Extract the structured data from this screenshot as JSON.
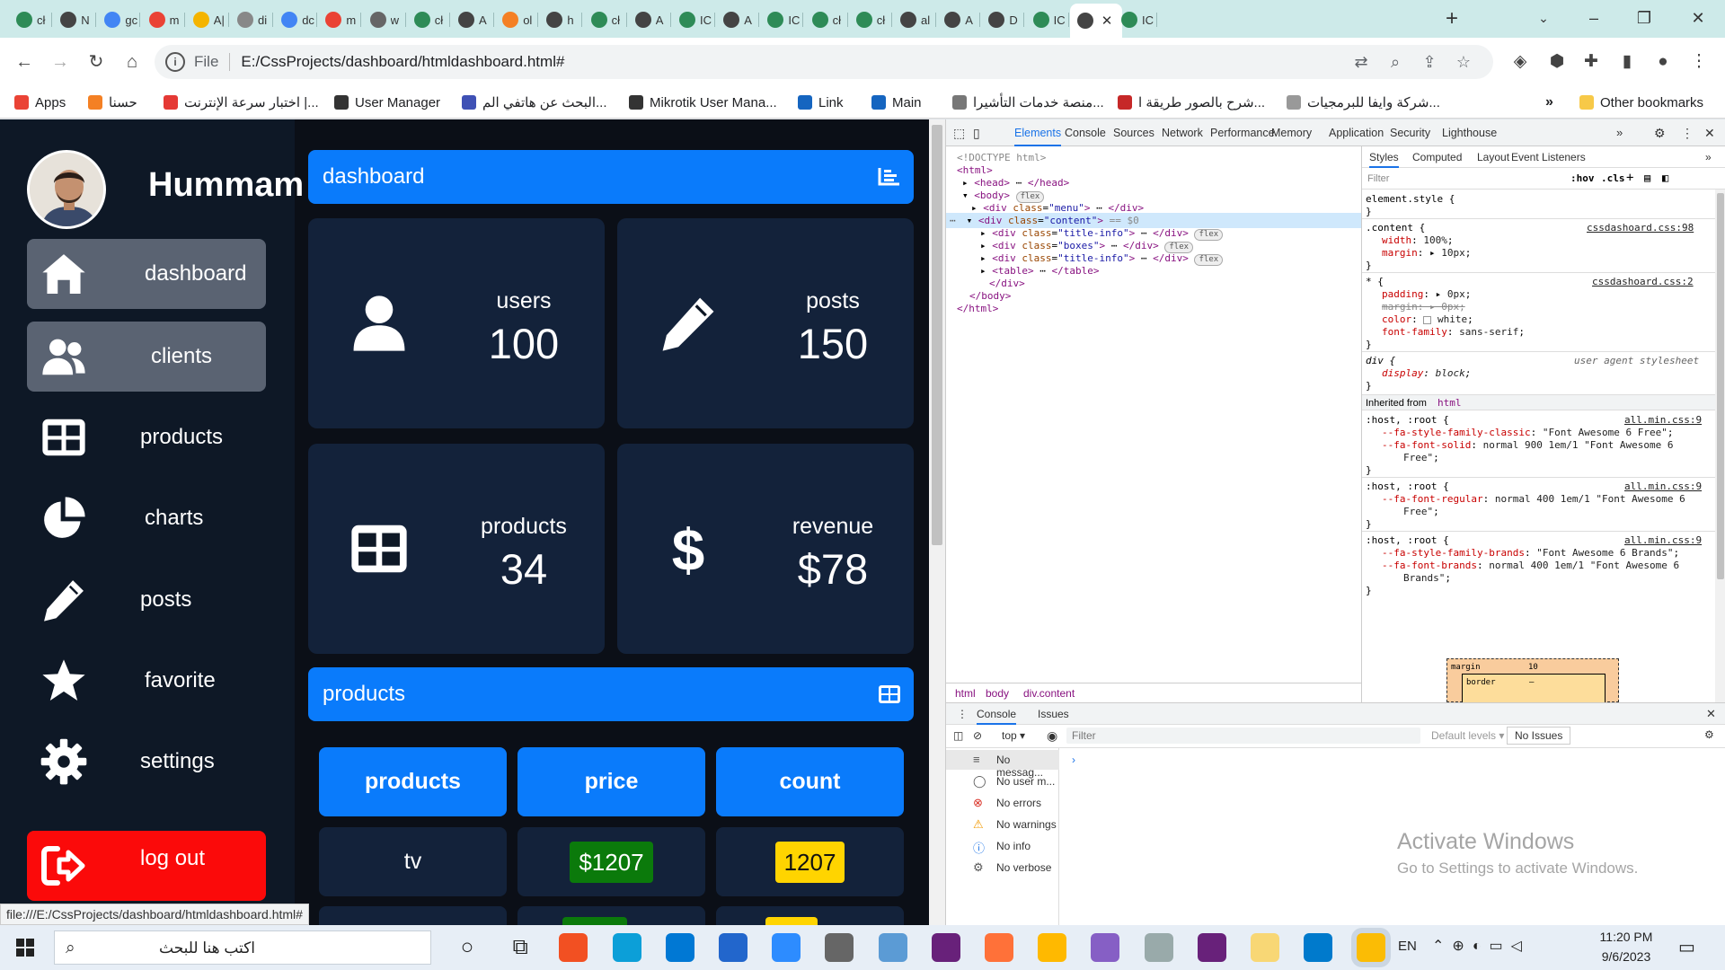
{
  "browser": {
    "tabs": [
      {
        "label": "cł",
        "color": "#2e8b57"
      },
      {
        "label": "N",
        "color": "#444"
      },
      {
        "label": "gc",
        "color": "#4285f4"
      },
      {
        "label": "m",
        "color": "#ea4335"
      },
      {
        "label": "A|",
        "color": "#f4b400"
      },
      {
        "label": "di",
        "color": "#888"
      },
      {
        "label": "dc",
        "color": "#4285f4"
      },
      {
        "label": "m",
        "color": "#ea4335"
      },
      {
        "label": "w",
        "color": "#666"
      },
      {
        "label": "cł",
        "color": "#2e8b57"
      },
      {
        "label": "A",
        "color": "#444"
      },
      {
        "label": "ol",
        "color": "#f48024"
      },
      {
        "label": "h",
        "color": "#444"
      },
      {
        "label": "cł",
        "color": "#2e8b57"
      },
      {
        "label": "A",
        "color": "#444"
      },
      {
        "label": "IC",
        "color": "#2e8b57"
      },
      {
        "label": "A",
        "color": "#444"
      },
      {
        "label": "IC",
        "color": "#2e8b57"
      },
      {
        "label": "cł",
        "color": "#2e8b57"
      },
      {
        "label": "cł",
        "color": "#2e8b57"
      },
      {
        "label": "al",
        "color": "#444"
      },
      {
        "label": "A",
        "color": "#444"
      },
      {
        "label": "D",
        "color": "#444"
      },
      {
        "label": "IC",
        "color": "#2e8b57"
      },
      {
        "label": "",
        "color": "#444",
        "active": true
      },
      {
        "label": "IC",
        "color": "#2e8b57"
      }
    ],
    "new_tab_icon": "plus-icon",
    "address": {
      "scheme_label": "File",
      "url": "E:/CssProjects/dashboard/htmldashboard.html#"
    },
    "bookmarks": [
      {
        "label": "Apps",
        "color": "#ea4335"
      },
      {
        "label": "حسنا",
        "color": "#f48024"
      },
      {
        "label": "اختبار سرعة الإنترنت |...",
        "color": "#e53935"
      },
      {
        "label": "User Manager",
        "color": "#333"
      },
      {
        "label": "البحث عن هاتفي الم...",
        "color": "#3f51b5"
      },
      {
        "label": "Mikrotik User Mana...",
        "color": "#333"
      },
      {
        "label": "Link",
        "color": "#1565c0"
      },
      {
        "label": "Main",
        "color": "#1565c0"
      },
      {
        "label": "منصة خدمات التأشيرا...",
        "color": "#777"
      },
      {
        "label": "شرح بالصور طريقة ا...",
        "color": "#c62828"
      },
      {
        "label": "شركة وايفا للبرمجيات...",
        "color": "#999"
      }
    ],
    "other_bookmarks": "Other bookmarks",
    "status_url": "file:///E:/CssProjects/dashboard/htmldashboard.html#"
  },
  "sidebar": {
    "user_name": "Hummam",
    "items": [
      {
        "label": "dashboard",
        "icon": "house-icon",
        "highlight": true
      },
      {
        "label": "clients",
        "icon": "users-icon",
        "highlight": true
      },
      {
        "label": "products",
        "icon": "table-icon",
        "highlight": false
      },
      {
        "label": "charts",
        "icon": "pie-chart-icon",
        "highlight": false
      },
      {
        "label": "posts",
        "icon": "pencil-icon",
        "highlight": false
      },
      {
        "label": "favorite",
        "icon": "star-icon",
        "highlight": false
      },
      {
        "label": "settings",
        "icon": "gear-icon",
        "highlight": false
      }
    ],
    "logout": "log out"
  },
  "content": {
    "title": "dashboard",
    "boxes": [
      {
        "name": "users",
        "value": "100",
        "icon": "user-icon"
      },
      {
        "name": "posts",
        "value": "150",
        "icon": "pencil-icon"
      },
      {
        "name": "products",
        "value": "34",
        "icon": "table-icon"
      },
      {
        "name": "revenue",
        "value": "$78",
        "icon": "dollar-icon"
      }
    ],
    "products_title": "products",
    "table": {
      "headers": [
        "products",
        "price",
        "count"
      ],
      "rows": [
        {
          "product": "tv",
          "price": "$1207",
          "count": "1207"
        }
      ],
      "price_color": "#0b7a0b",
      "count_color": "#ffd400"
    }
  },
  "devtools": {
    "tabs": [
      "Elements",
      "Console",
      "Sources",
      "Network",
      "Performance",
      "Memory",
      "Application",
      "Security",
      "Lighthouse"
    ],
    "dom": {
      "doctype": "<!DOCTYPE html>",
      "selected_suffix": "== $0"
    },
    "breadcrumbs": [
      "html",
      "body",
      "div.content"
    ],
    "style_tabs": [
      "Styles",
      "Computed",
      "Layout",
      "Event Listeners"
    ],
    "filter_placeholder": "Filter",
    "hov": ":hov",
    "cls": ".cls",
    "inherited": "Inherited from",
    "box_model": {
      "margin_label": "margin",
      "margin_value": "10",
      "border_label": "border",
      "border_value": "–"
    },
    "console": {
      "tabs": [
        "Console",
        "Issues"
      ],
      "context": "top",
      "filter_placeholder": "Filter",
      "levels": "Default levels",
      "issues": "No Issues",
      "sidebar": [
        "No messag...",
        "No user m...",
        "No errors",
        "No warnings",
        "No info",
        "No verbose"
      ]
    },
    "watermark_title": "Activate Windows",
    "watermark_sub": "Go to Settings to activate Windows."
  },
  "taskbar": {
    "search_placeholder": "اكتب هنا للبحث",
    "lang": "EN",
    "time": "11:20 PM",
    "date": "9/6/2023"
  }
}
